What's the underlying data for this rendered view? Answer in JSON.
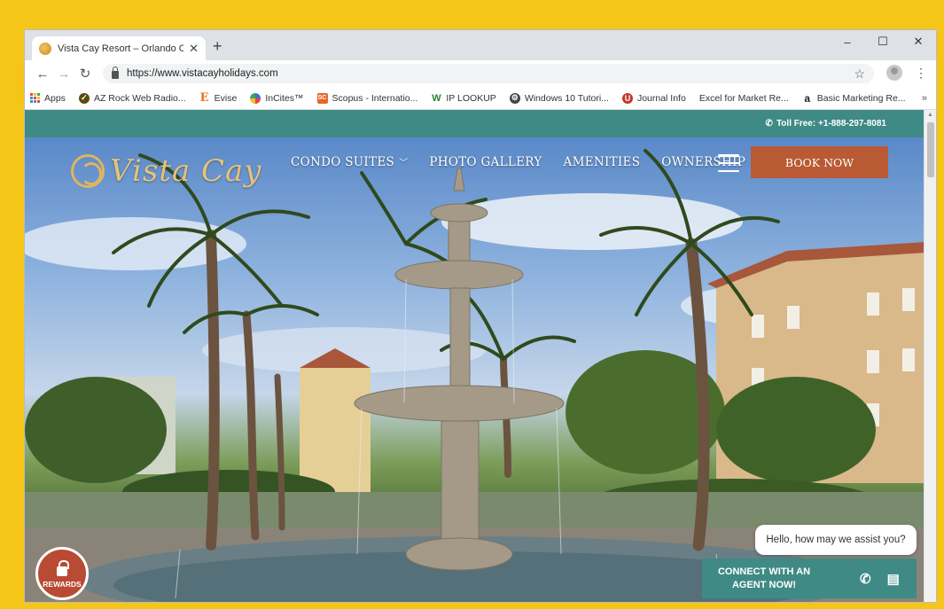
{
  "browser": {
    "tab_title": "Vista Cay Resort – Orlando Cond",
    "tab_close": "✕",
    "new_tab": "+",
    "window_controls": [
      "–",
      "☐",
      "✕"
    ],
    "url": "https://www.vistacayholidays.com",
    "bookmarks": [
      {
        "label": "Apps",
        "color": "#e8453c"
      },
      {
        "label": "AZ Rock Web Radio...",
        "color": "#333333"
      },
      {
        "label": "Evise",
        "color": "#e8731a"
      },
      {
        "label": "InCites™",
        "color": "#3f6fd8"
      },
      {
        "label": "Scopus - Internatio...",
        "color": "#e5672b"
      },
      {
        "label": "IP LOOKUP",
        "color": "#2e7d32"
      },
      {
        "label": "Windows 10 Tutori...",
        "color": "#444444"
      },
      {
        "label": "Journal Info",
        "color": "#c0392b"
      },
      {
        "label": "Excel for Market Re...",
        "color": "#ffffff"
      },
      {
        "label": "Basic Marketing Re...",
        "color": "#222222"
      }
    ],
    "bookmarks_more": "»"
  },
  "site": {
    "toll_free": "Toll Free: +1-888-297-8081",
    "logo_text": "Vista Cay",
    "nav": {
      "condo_suites": "CONDO SUITES",
      "photo_gallery": "PHOTO GALLERY",
      "amenities": "AMENITIES",
      "ownership": "OWNERSHIP"
    },
    "book_now": "BOOK NOW",
    "rewards": "REWARDS",
    "chat_prompt": "Hello, how may we assist you?",
    "connect_line1": "CONNECT WITH AN",
    "connect_line2": "AGENT NOW!"
  },
  "colors": {
    "teal": "#3f8a85",
    "book_button": "#b95a34",
    "frame": "#f5c518"
  }
}
